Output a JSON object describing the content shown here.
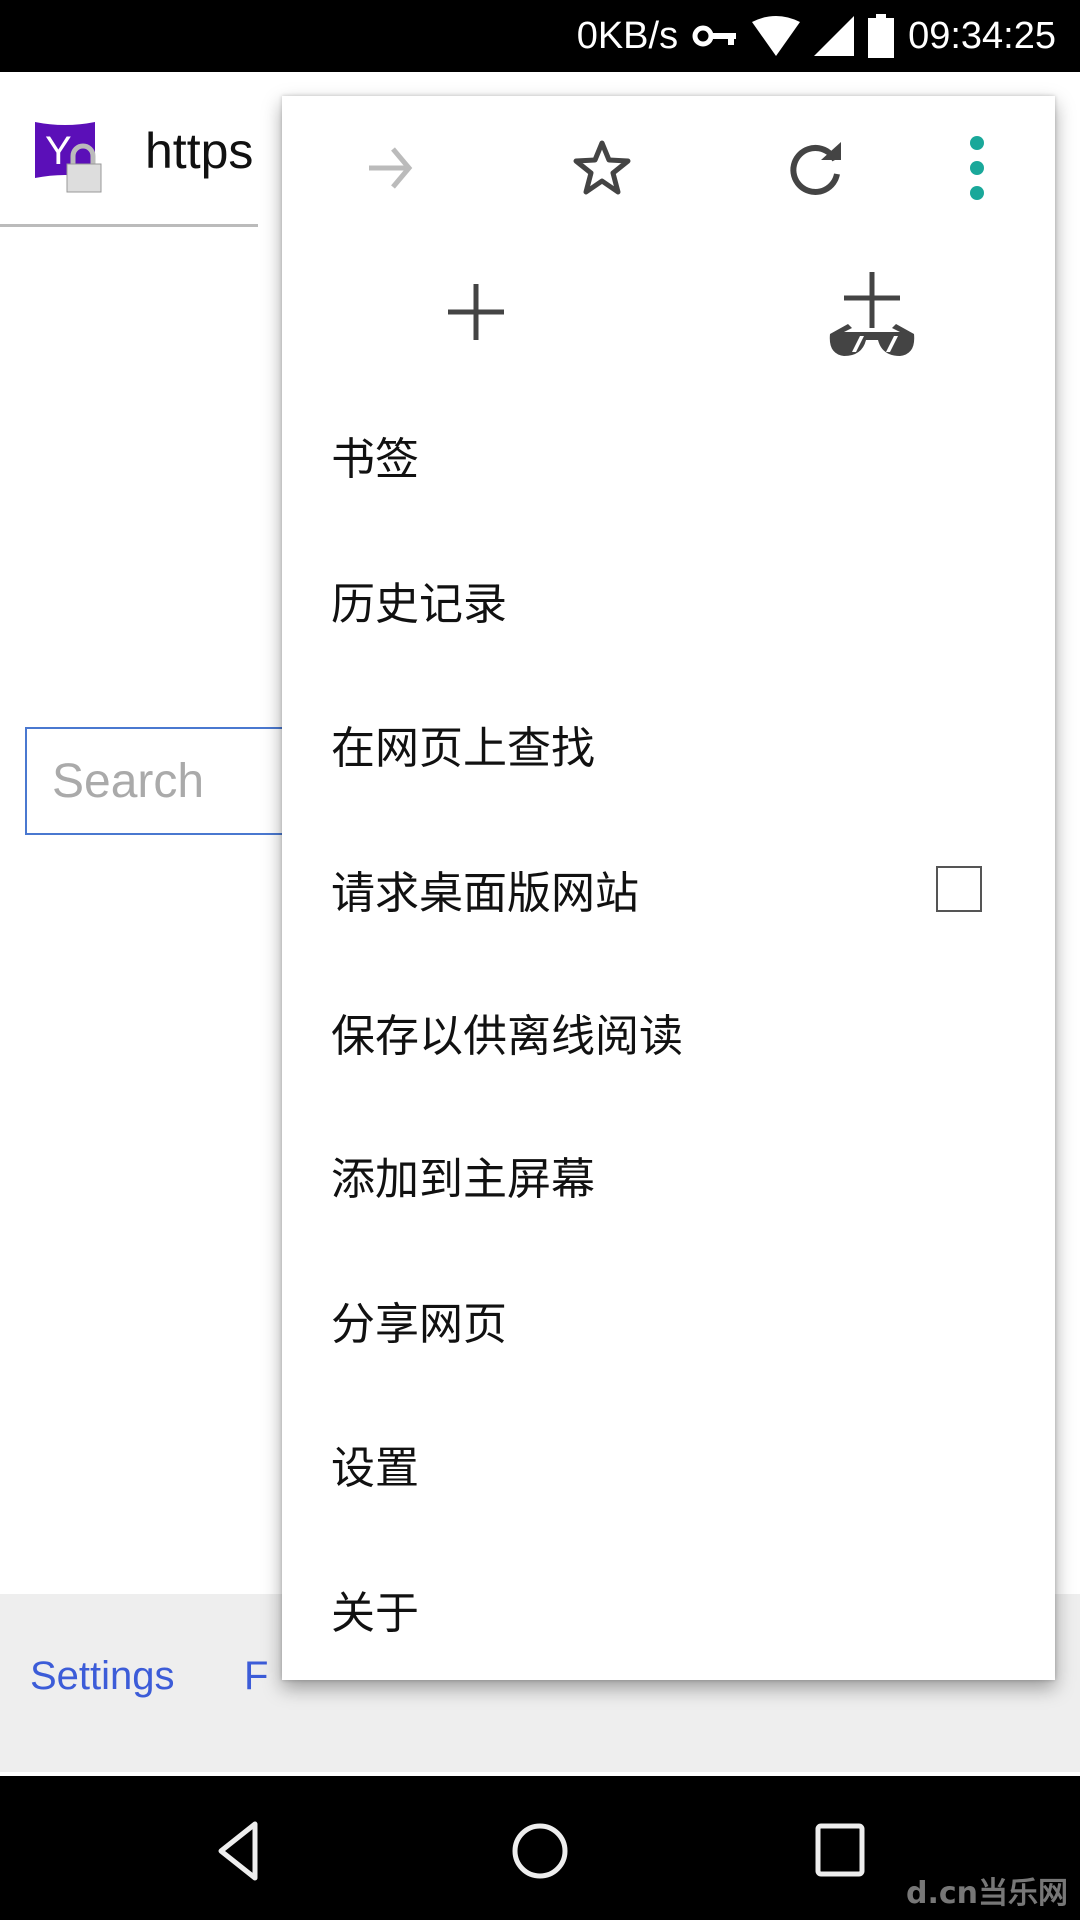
{
  "status_bar": {
    "network_speed": "0KB/s",
    "time": "09:34:25",
    "icons": [
      "vpn-key-icon",
      "wifi-icon",
      "signal-icon",
      "battery-icon"
    ]
  },
  "page": {
    "url_partial": "https",
    "search_placeholder": "Search",
    "footer_links": [
      "Settings",
      "F"
    ]
  },
  "menu": {
    "toolbar": [
      "forward-icon",
      "bookmark-star-icon",
      "reload-icon",
      "more-vert-icon"
    ],
    "actions": [
      "new-tab-icon",
      "new-incognito-tab-icon"
    ],
    "items": [
      {
        "label": "书签"
      },
      {
        "label": "历史记录"
      },
      {
        "label": "在网页上查找"
      },
      {
        "label": "请求桌面版网站",
        "checkbox": false
      },
      {
        "label": "保存以供离线阅读"
      },
      {
        "label": "添加到主屏幕"
      },
      {
        "label": "分享网页"
      },
      {
        "label": "设置"
      },
      {
        "label": "关于"
      }
    ],
    "accent_color": "#1aa89a"
  },
  "watermark": "d.cn当乐网"
}
